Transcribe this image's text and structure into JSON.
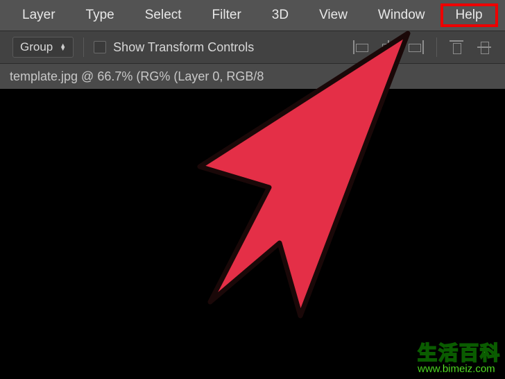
{
  "menubar": {
    "items": [
      {
        "label": "Layer"
      },
      {
        "label": "Type"
      },
      {
        "label": "Select"
      },
      {
        "label": "Filter"
      },
      {
        "label": "3D"
      },
      {
        "label": "View"
      },
      {
        "label": "Window"
      },
      {
        "label": "Help"
      }
    ],
    "highlighted_index": 7
  },
  "options": {
    "group_label": "Group",
    "show_transform_label": "Show Transform Controls",
    "show_transform_checked": false
  },
  "document_tab": {
    "prefix": "template.jpg @ 66.7% (RG",
    "suffix": "% (Layer 0, RGB/8"
  },
  "watermark": {
    "cn": "生活百科",
    "url": "www.bimeiz.com"
  },
  "highlight_color": "#ee0000",
  "arrow_color": "#e42f47"
}
